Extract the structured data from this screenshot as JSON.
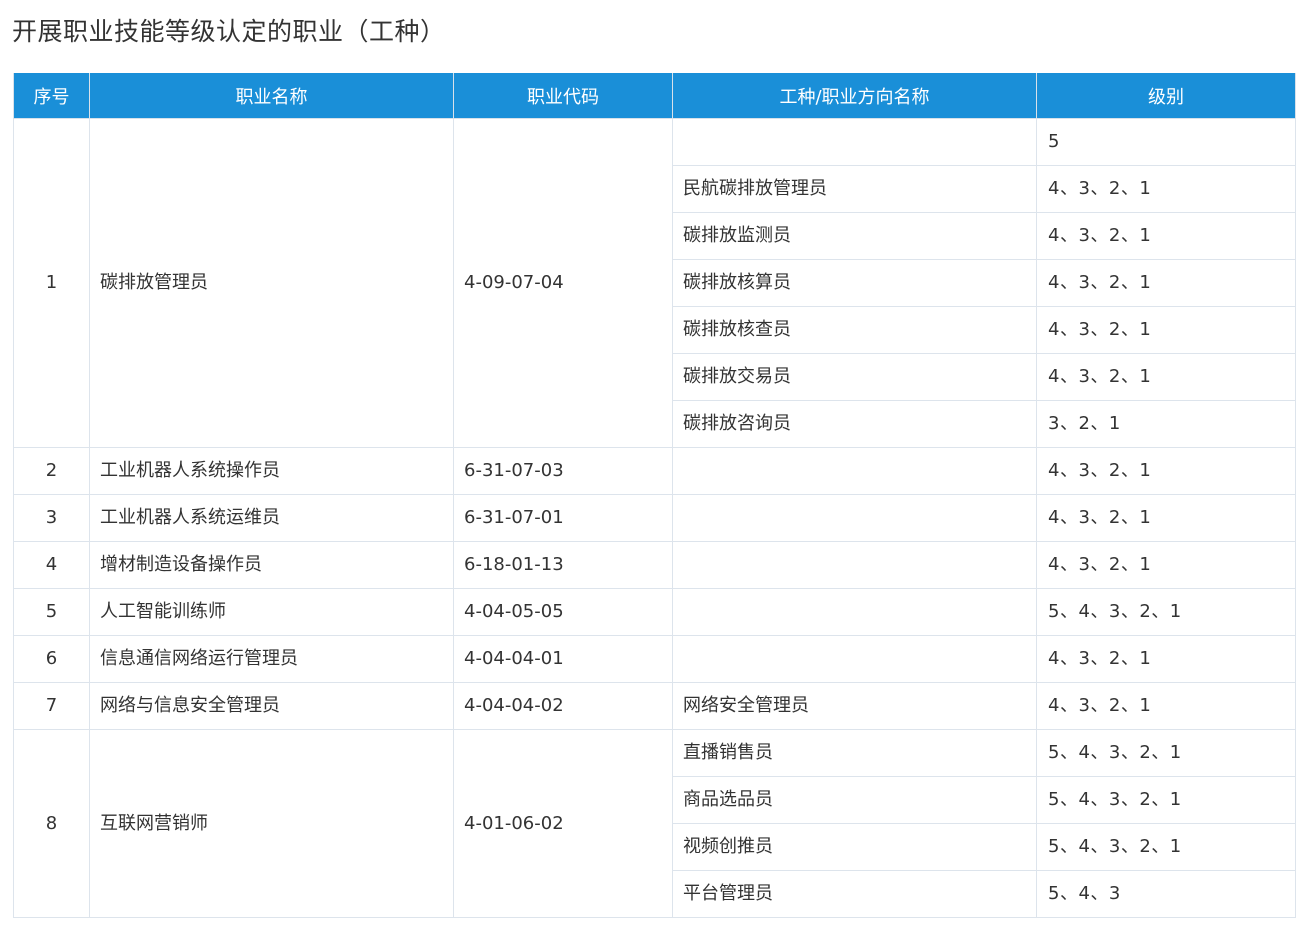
{
  "title": "开展职业技能等级认定的职业（工种）",
  "table": {
    "headers": [
      "序号",
      "职业名称",
      "职业代码",
      "工种/职业方向名称",
      "级别"
    ],
    "occupations": [
      {
        "no": "1",
        "name": "碳排放管理员",
        "code": "4-09-07-04",
        "rows": [
          {
            "work_type": "",
            "levels": "5"
          },
          {
            "work_type": "民航碳排放管理员",
            "levels": "4、3、2、1"
          },
          {
            "work_type": "碳排放监测员",
            "levels": "4、3、2、1"
          },
          {
            "work_type": "碳排放核算员",
            "levels": "4、3、2、1"
          },
          {
            "work_type": "碳排放核查员",
            "levels": "4、3、2、1"
          },
          {
            "work_type": "碳排放交易员",
            "levels": "4、3、2、1"
          },
          {
            "work_type": "碳排放咨询员",
            "levels": "3、2、1"
          }
        ]
      },
      {
        "no": "2",
        "name": "工业机器人系统操作员",
        "code": "6-31-07-03",
        "rows": [
          {
            "work_type": "",
            "levels": "4、3、2、1"
          }
        ]
      },
      {
        "no": "3",
        "name": "工业机器人系统运维员",
        "code": "6-31-07-01",
        "rows": [
          {
            "work_type": "",
            "levels": "4、3、2、1"
          }
        ]
      },
      {
        "no": "4",
        "name": "增材制造设备操作员",
        "code": "6-18-01-13",
        "rows": [
          {
            "work_type": "",
            "levels": "4、3、2、1"
          }
        ]
      },
      {
        "no": "5",
        "name": "人工智能训练师",
        "code": "4-04-05-05",
        "rows": [
          {
            "work_type": "",
            "levels": "5、4、3、2、1"
          }
        ]
      },
      {
        "no": "6",
        "name": "信息通信网络运行管理员",
        "code": "4-04-04-01",
        "rows": [
          {
            "work_type": "",
            "levels": "4、3、2、1"
          }
        ]
      },
      {
        "no": "7",
        "name": "网络与信息安全管理员",
        "code": "4-04-04-02",
        "rows": [
          {
            "work_type": "网络安全管理员",
            "levels": "4、3、2、1"
          }
        ]
      },
      {
        "no": "8",
        "name": "互联网营销师",
        "code": "4-01-06-02",
        "rows": [
          {
            "work_type": "直播销售员",
            "levels": "5、4、3、2、1"
          },
          {
            "work_type": "商品选品员",
            "levels": "5、4、3、2、1"
          },
          {
            "work_type": "视频创推员",
            "levels": "5、4、3、2、1"
          },
          {
            "work_type": "平台管理员",
            "levels": "5、4、3"
          }
        ]
      }
    ]
  }
}
